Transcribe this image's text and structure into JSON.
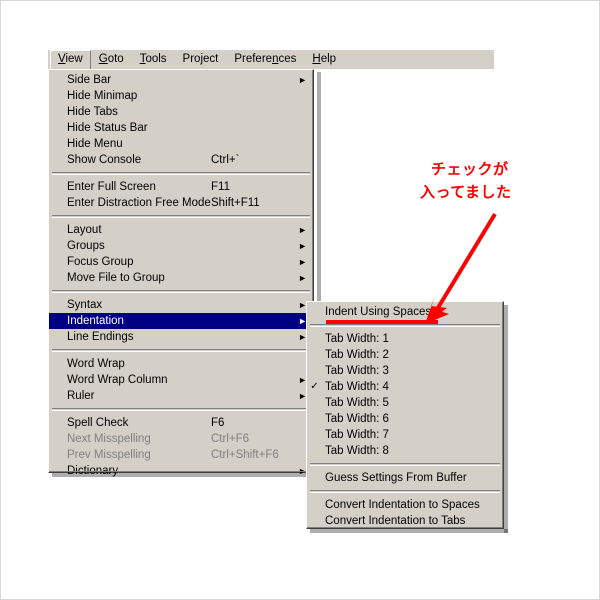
{
  "app": {
    "theme_bg": "#d4d0c8",
    "highlight_color": "#000080",
    "annotation_color": "#ff0000"
  },
  "menubar": {
    "items": [
      {
        "label": "View",
        "accel": "V",
        "active": true
      },
      {
        "label": "Goto",
        "accel": "G",
        "active": false
      },
      {
        "label": "Tools",
        "accel": "T",
        "active": false
      },
      {
        "label": "Project",
        "accel": "",
        "active": false
      },
      {
        "label": "Preferences",
        "accel": "n",
        "active": false
      },
      {
        "label": "Help",
        "accel": "H",
        "active": false
      }
    ]
  },
  "view_menu": {
    "items": [
      {
        "label": "Side Bar",
        "shortcut": "",
        "submenu": true,
        "checked": false,
        "disabled": false,
        "highlight": false
      },
      {
        "label": "Hide Minimap",
        "shortcut": "",
        "submenu": false,
        "checked": false,
        "disabled": false,
        "highlight": false
      },
      {
        "label": "Hide Tabs",
        "shortcut": "",
        "submenu": false,
        "checked": false,
        "disabled": false,
        "highlight": false
      },
      {
        "label": "Hide Status Bar",
        "shortcut": "",
        "submenu": false,
        "checked": false,
        "disabled": false,
        "highlight": false
      },
      {
        "label": "Hide Menu",
        "shortcut": "",
        "submenu": false,
        "checked": false,
        "disabled": false,
        "highlight": false
      },
      {
        "label": "Show Console",
        "shortcut": "Ctrl+`",
        "submenu": false,
        "checked": false,
        "disabled": false,
        "highlight": false
      },
      {
        "separator": true
      },
      {
        "label": "Enter Full Screen",
        "shortcut": "F11",
        "submenu": false,
        "checked": false,
        "disabled": false,
        "highlight": false
      },
      {
        "label": "Enter Distraction Free Mode",
        "shortcut": "Shift+F11",
        "submenu": false,
        "checked": false,
        "disabled": false,
        "highlight": false
      },
      {
        "separator": true
      },
      {
        "label": "Layout",
        "shortcut": "",
        "submenu": true,
        "checked": false,
        "disabled": false,
        "highlight": false
      },
      {
        "label": "Groups",
        "shortcut": "",
        "submenu": true,
        "checked": false,
        "disabled": false,
        "highlight": false
      },
      {
        "label": "Focus Group",
        "shortcut": "",
        "submenu": true,
        "checked": false,
        "disabled": false,
        "highlight": false
      },
      {
        "label": "Move File to Group",
        "shortcut": "",
        "submenu": true,
        "checked": false,
        "disabled": false,
        "highlight": false
      },
      {
        "separator": true
      },
      {
        "label": "Syntax",
        "shortcut": "",
        "submenu": true,
        "checked": false,
        "disabled": false,
        "highlight": false
      },
      {
        "label": "Indentation",
        "shortcut": "",
        "submenu": true,
        "checked": false,
        "disabled": false,
        "highlight": true
      },
      {
        "label": "Line Endings",
        "shortcut": "",
        "submenu": true,
        "checked": false,
        "disabled": false,
        "highlight": false
      },
      {
        "separator": true
      },
      {
        "label": "Word Wrap",
        "shortcut": "",
        "submenu": false,
        "checked": false,
        "disabled": false,
        "highlight": false
      },
      {
        "label": "Word Wrap Column",
        "shortcut": "",
        "submenu": true,
        "checked": false,
        "disabled": false,
        "highlight": false
      },
      {
        "label": "Ruler",
        "shortcut": "",
        "submenu": true,
        "checked": false,
        "disabled": false,
        "highlight": false
      },
      {
        "separator": true
      },
      {
        "label": "Spell Check",
        "shortcut": "F6",
        "submenu": false,
        "checked": false,
        "disabled": false,
        "highlight": false
      },
      {
        "label": "Next Misspelling",
        "shortcut": "Ctrl+F6",
        "submenu": false,
        "checked": false,
        "disabled": true,
        "highlight": false
      },
      {
        "label": "Prev Misspelling",
        "shortcut": "Ctrl+Shift+F6",
        "submenu": false,
        "checked": false,
        "disabled": true,
        "highlight": false
      },
      {
        "label": "Dictionary",
        "shortcut": "",
        "submenu": true,
        "checked": false,
        "disabled": false,
        "highlight": false
      }
    ]
  },
  "indentation_submenu": {
    "items": [
      {
        "label": "Indent Using Spaces",
        "checked": false,
        "submenu": false,
        "disabled": false,
        "annotated": true
      },
      {
        "separator": true
      },
      {
        "label": "Tab Width: 1",
        "checked": false,
        "submenu": false,
        "disabled": false
      },
      {
        "label": "Tab Width: 2",
        "checked": false,
        "submenu": false,
        "disabled": false
      },
      {
        "label": "Tab Width: 3",
        "checked": false,
        "submenu": false,
        "disabled": false
      },
      {
        "label": "Tab Width: 4",
        "checked": true,
        "submenu": false,
        "disabled": false
      },
      {
        "label": "Tab Width: 5",
        "checked": false,
        "submenu": false,
        "disabled": false
      },
      {
        "label": "Tab Width: 6",
        "checked": false,
        "submenu": false,
        "disabled": false
      },
      {
        "label": "Tab Width: 7",
        "checked": false,
        "submenu": false,
        "disabled": false
      },
      {
        "label": "Tab Width: 8",
        "checked": false,
        "submenu": false,
        "disabled": false
      },
      {
        "separator": true
      },
      {
        "label": "Guess Settings From Buffer",
        "checked": false,
        "submenu": false,
        "disabled": false
      },
      {
        "separator": true
      },
      {
        "label": "Convert Indentation to Spaces",
        "checked": false,
        "submenu": false,
        "disabled": false
      },
      {
        "label": "Convert Indentation to Tabs",
        "checked": false,
        "submenu": false,
        "disabled": false
      }
    ]
  },
  "annotation": {
    "line1": "チェックが",
    "line2": "入ってました",
    "color": "#ff0000",
    "points_at": "Indent Using Spaces"
  },
  "icons": {
    "submenu_arrow": "►",
    "checkmark": "✓"
  }
}
